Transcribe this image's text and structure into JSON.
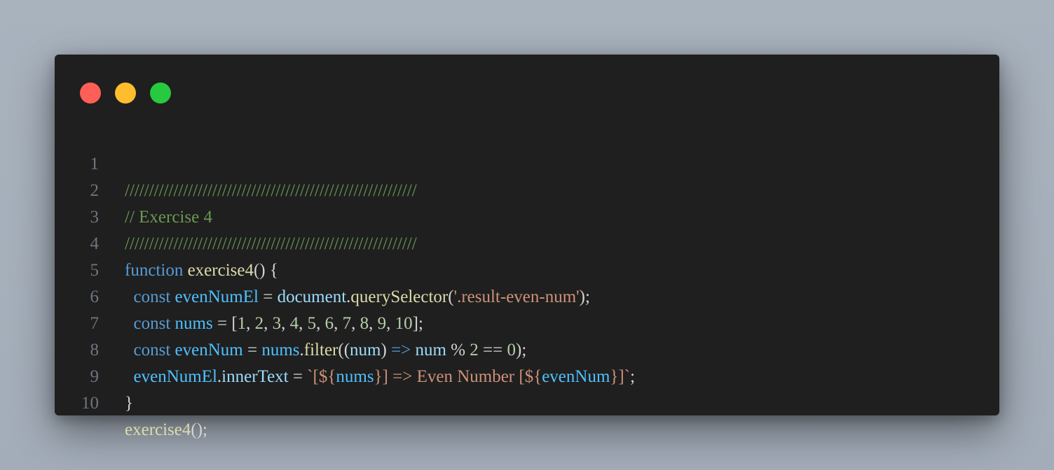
{
  "window": {
    "buttons": {
      "close_color": "#ff5f56",
      "minimize_color": "#ffbd2e",
      "maximize_color": "#27c93f"
    }
  },
  "code": {
    "line_numbers": [
      "1",
      "2",
      "3",
      "4",
      "5",
      "6",
      "7",
      "8",
      "9",
      "10"
    ],
    "lines": [
      [
        {
          "t": "cm",
          "v": "////////////////////////////////////////////////////////////"
        }
      ],
      [
        {
          "t": "cm",
          "v": "// Exercise 4"
        }
      ],
      [
        {
          "t": "cm",
          "v": "////////////////////////////////////////////////////////////"
        }
      ],
      [
        {
          "t": "kw",
          "v": "function"
        },
        {
          "t": "pun",
          "v": " "
        },
        {
          "t": "fn",
          "v": "exercise4"
        },
        {
          "t": "pun",
          "v": "() {"
        }
      ],
      [
        {
          "t": "pun",
          "v": "  "
        },
        {
          "t": "kw",
          "v": "const"
        },
        {
          "t": "pun",
          "v": " "
        },
        {
          "t": "var",
          "v": "evenNumEl"
        },
        {
          "t": "pun",
          "v": " = "
        },
        {
          "t": "prop",
          "v": "document"
        },
        {
          "t": "pun",
          "v": "."
        },
        {
          "t": "fn",
          "v": "querySelector"
        },
        {
          "t": "pun",
          "v": "("
        },
        {
          "t": "str",
          "v": "'.result-even-num'"
        },
        {
          "t": "pun",
          "v": ");"
        }
      ],
      [
        {
          "t": "pun",
          "v": "  "
        },
        {
          "t": "kw",
          "v": "const"
        },
        {
          "t": "pun",
          "v": " "
        },
        {
          "t": "var",
          "v": "nums"
        },
        {
          "t": "pun",
          "v": " = ["
        },
        {
          "t": "num",
          "v": "1"
        },
        {
          "t": "pun",
          "v": ", "
        },
        {
          "t": "num",
          "v": "2"
        },
        {
          "t": "pun",
          "v": ", "
        },
        {
          "t": "num",
          "v": "3"
        },
        {
          "t": "pun",
          "v": ", "
        },
        {
          "t": "num",
          "v": "4"
        },
        {
          "t": "pun",
          "v": ", "
        },
        {
          "t": "num",
          "v": "5"
        },
        {
          "t": "pun",
          "v": ", "
        },
        {
          "t": "num",
          "v": "6"
        },
        {
          "t": "pun",
          "v": ", "
        },
        {
          "t": "num",
          "v": "7"
        },
        {
          "t": "pun",
          "v": ", "
        },
        {
          "t": "num",
          "v": "8"
        },
        {
          "t": "pun",
          "v": ", "
        },
        {
          "t": "num",
          "v": "9"
        },
        {
          "t": "pun",
          "v": ", "
        },
        {
          "t": "num",
          "v": "10"
        },
        {
          "t": "pun",
          "v": "];"
        }
      ],
      [
        {
          "t": "pun",
          "v": "  "
        },
        {
          "t": "kw",
          "v": "const"
        },
        {
          "t": "pun",
          "v": " "
        },
        {
          "t": "var",
          "v": "evenNum"
        },
        {
          "t": "pun",
          "v": " = "
        },
        {
          "t": "var",
          "v": "nums"
        },
        {
          "t": "pun",
          "v": "."
        },
        {
          "t": "fn",
          "v": "filter"
        },
        {
          "t": "pun",
          "v": "(("
        },
        {
          "t": "prop",
          "v": "num"
        },
        {
          "t": "pun",
          "v": ") "
        },
        {
          "t": "op",
          "v": "=>"
        },
        {
          "t": "pun",
          "v": " "
        },
        {
          "t": "prop",
          "v": "num"
        },
        {
          "t": "pun",
          "v": " % "
        },
        {
          "t": "num",
          "v": "2"
        },
        {
          "t": "pun",
          "v": " == "
        },
        {
          "t": "num",
          "v": "0"
        },
        {
          "t": "pun",
          "v": ");"
        }
      ],
      [
        {
          "t": "pun",
          "v": "  "
        },
        {
          "t": "var",
          "v": "evenNumEl"
        },
        {
          "t": "pun",
          "v": "."
        },
        {
          "t": "prop",
          "v": "innerText"
        },
        {
          "t": "pun",
          "v": " = "
        },
        {
          "t": "str",
          "v": "`[${"
        },
        {
          "t": "var",
          "v": "nums"
        },
        {
          "t": "str",
          "v": "}] => Even Number [${"
        },
        {
          "t": "var",
          "v": "evenNum"
        },
        {
          "t": "str",
          "v": "}]`"
        },
        {
          "t": "pun",
          "v": ";"
        }
      ],
      [
        {
          "t": "pun",
          "v": "}"
        }
      ],
      [
        {
          "t": "fn",
          "v": "exercise4"
        },
        {
          "t": "pun",
          "v": "();"
        }
      ]
    ]
  }
}
